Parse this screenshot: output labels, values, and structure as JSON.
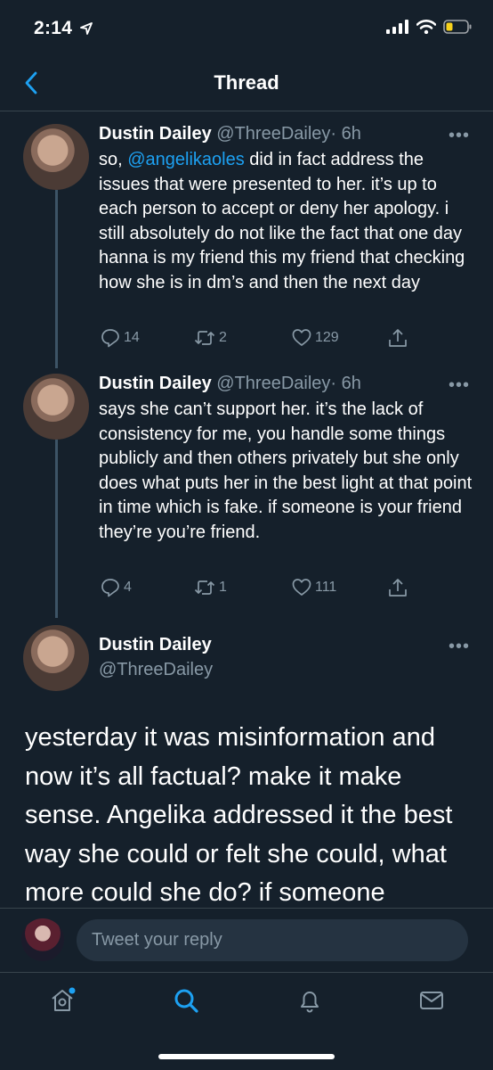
{
  "status_bar": {
    "time": "2:14"
  },
  "nav": {
    "title": "Thread"
  },
  "tweets": [
    {
      "name": "Dustin Dailey",
      "handle": "@ThreeDailey",
      "time": "· 6h",
      "mention": "@angelikaoles",
      "text_prefix": "so, ",
      "text_rest": " did in fact address the issues that were presented to her. it’s up to each person to accept or deny her apology. i still absolutely do not like the fact that one day hanna is my friend this my friend that checking how she is in dm’s and then the next day",
      "replies": "14",
      "retweets": "2",
      "likes": "129"
    },
    {
      "name": "Dustin Dailey",
      "handle": "@ThreeDailey",
      "time": "· 6h",
      "text": "says she can’t support her. it’s the lack of consistency for me, you handle some things publicly and then others privately but she only does what puts her in the best light at that point in time which is fake. if someone is your friend they’re you’re friend.",
      "replies": "4",
      "retweets": "1",
      "likes": "111"
    }
  ],
  "main_tweet": {
    "name": "Dustin Dailey",
    "handle": "@ThreeDailey",
    "text": "yesterday it was misinformation and now it’s all factual? make it make sense. Angelika addressed it the best way she could or felt she could, what more could she do? if someone"
  },
  "reply": {
    "placeholder": "Tweet your reply"
  },
  "colors": {
    "background": "#15202b",
    "accent": "#1da1f2",
    "muted": "#8899a6",
    "battery": "#f8d21c"
  }
}
